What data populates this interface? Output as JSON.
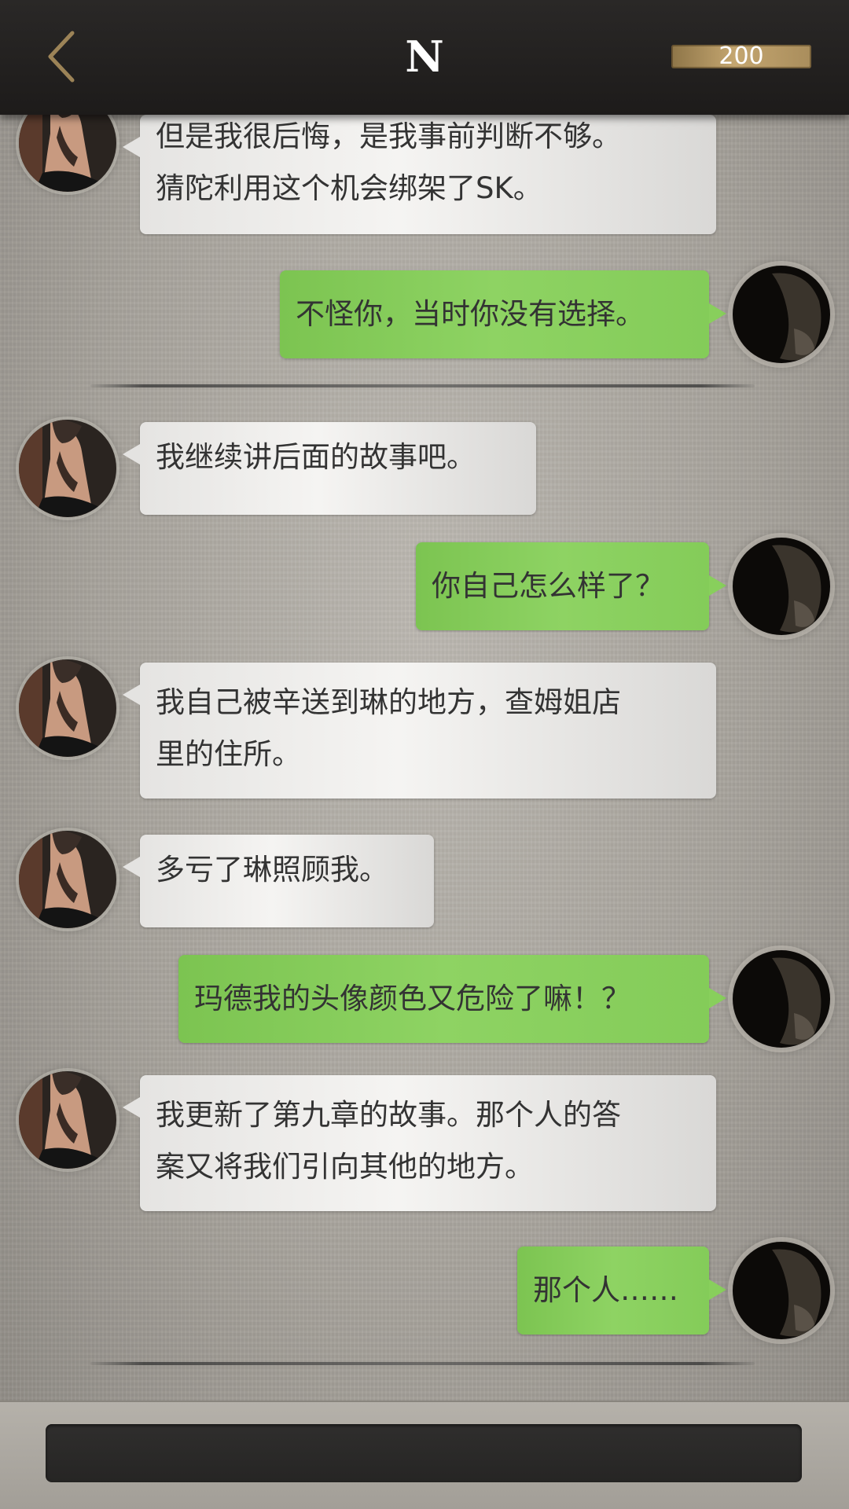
{
  "header": {
    "title": "N",
    "coins": "200",
    "back_icon": "chevron-left-icon"
  },
  "colors": {
    "header_bg": "#1f1d1c",
    "incoming_bubble": "#eeeeec",
    "outgoing_bubble": "#86cd5b",
    "coin_badge": "#b89c66",
    "input_bg": "#2b2a29"
  },
  "messages": [
    {
      "side": "left",
      "lines": [
        "但是我很后悔，是我事前判断不够。",
        "猜陀利用这个机会绑架了SK。"
      ]
    },
    {
      "side": "right",
      "text": "不怪你，当时你没有选择。"
    },
    {
      "side": "left",
      "text": "我继续讲后面的故事吧。"
    },
    {
      "side": "right",
      "text": "你自己怎么样了？"
    },
    {
      "side": "left",
      "lines": [
        "我自己被辛送到琳的地方，查姆姐店",
        "里的住所。"
      ]
    },
    {
      "side": "left",
      "text": "多亏了琳照顾我。"
    },
    {
      "side": "right",
      "text": "玛德我的头像颜色又危险了嘛！？"
    },
    {
      "side": "left",
      "lines": [
        "我更新了第九章的故事。那个人的答",
        "案又将我们引向其他的地方。"
      ]
    },
    {
      "side": "right",
      "text": "那个人……"
    }
  ],
  "input": {
    "placeholder": ""
  }
}
